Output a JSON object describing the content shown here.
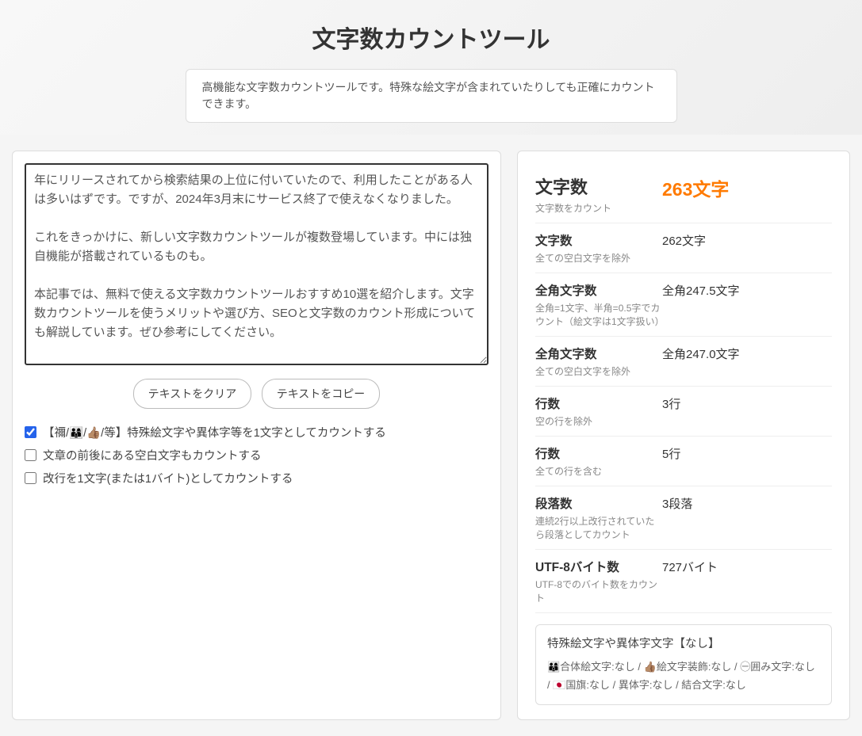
{
  "header": {
    "title": "文字数カウントツール",
    "description": "高機能な文字数カウントツールです。特殊な絵文字が含まれていたりしても正確にカウントできます。"
  },
  "textarea": {
    "content": "年にリリースされてから検索結果の上位に付いていたので、利用したことがある人は多いはずです。ですが、2024年3月末にサービス終了で使えなくなりました。\n\nこれをきっかけに、新しい文字数カウントツールが複数登場しています。中には独自機能が搭載されているものも。\n\n本記事では、無料で使える文字数カウントツールおすすめ10選を紹介します。文字数カウントツールを使うメリットや選び方、SEOと文字数のカウント形成についても解説しています。ぜひ参考にしてください。"
  },
  "buttons": {
    "clear": "テキストをクリア",
    "copy": "テキストをコピー"
  },
  "options": {
    "opt1": {
      "checked": true,
      "label": "【禰/👨‍👩‍👦/👍🏽/等】特殊絵文字や異体字等を1文字としてカウントする"
    },
    "opt2": {
      "checked": false,
      "label": "文章の前後にある空白文字もカウントする"
    },
    "opt3": {
      "checked": false,
      "label": "改行を1文字(または1バイト)としてカウントする"
    }
  },
  "stats": {
    "s1": {
      "label": "文字数",
      "sub": "文字数をカウント",
      "value": "263文字"
    },
    "s2": {
      "label": "文字数",
      "sub": "全ての空白文字を除外",
      "value": "262文字"
    },
    "s3": {
      "label": "全角文字数",
      "sub": "全角=1文字、半角=0.5字でカウント（絵文字は1文字扱い）",
      "value": "全角247.5文字"
    },
    "s4": {
      "label": "全角文字数",
      "sub": "全ての空白文字を除外",
      "value": "全角247.0文字"
    },
    "s5": {
      "label": "行数",
      "sub": "空の行を除外",
      "value": "3行"
    },
    "s6": {
      "label": "行数",
      "sub": "全ての行を含む",
      "value": "5行"
    },
    "s7": {
      "label": "段落数",
      "sub": "連続2行以上改行されていたら段落としてカウント",
      "value": "3段落"
    },
    "s8": {
      "label": "UTF-8バイト数",
      "sub": "UTF-8でのバイト数をカウント",
      "value": "727バイト"
    }
  },
  "special": {
    "title": "特殊絵文字や異体字文字【なし】",
    "details": "👨‍👩‍👦合体絵文字:なし / 👍🏽絵文字装飾:なし / ㊀囲み文字:なし / 🇯🇵国旗:なし / 異体字:なし / 結合文字:なし"
  }
}
